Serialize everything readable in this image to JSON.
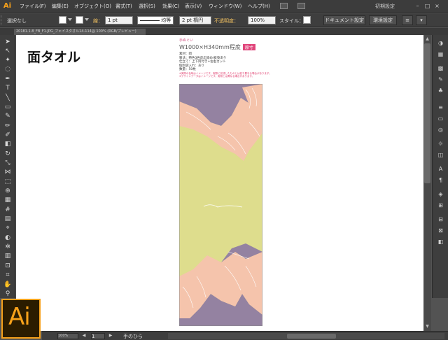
{
  "menubar": {
    "app_logo": "Ai",
    "items": [
      "ファイル(F)",
      "編集(E)",
      "オブジェクト(O)",
      "書式(T)",
      "選択(S)",
      "効果(C)",
      "表示(V)",
      "ウィンドウ(W)",
      "ヘルプ(H)"
    ],
    "workspace": "初期設定"
  },
  "controlbar": {
    "selection_state": "選択なし",
    "stroke_label": "線：",
    "stroke_weight": "1 pt",
    "profile_label": "均等",
    "brush_label": "2 pt 楕円",
    "opacity_label": "不透明度：",
    "opacity_value": "100%",
    "style_label": "スタイル：",
    "doc_setup_button": "ドキュメント設定",
    "preferences_button": "環境設定"
  },
  "tab": {
    "doc_name": "20181.1.8_FB_F1.JPG_フェイスタオル14-114@ 100% (RGB/プレビュー)"
  },
  "artboard": {
    "title": "面タオル",
    "spec": {
      "kind": "手ぬぐい",
      "size": "W1000×H340mm程度",
      "tag": "原寸",
      "lines": [
        "素材：岡",
        "製法：特色3色反応染め/抜染あり",
        "仕立て：上下阿付き+左右カット",
        "個別袋入れ：あり",
        "数量：50枚"
      ],
      "notes": [
        "※実際の色味はイメージです。実際に完成したものとは若干異なる場合があります。",
        "※デザインデータはイメージです。実物とは異なる場合があります。"
      ]
    },
    "colors": {
      "purple": "#9482a1",
      "peach": "#f5c4ac",
      "khaki": "#dedd8d",
      "border": "#8a8a8a"
    }
  },
  "statusbar": {
    "zoom": "100%",
    "page": "1",
    "current_tool": "手のひら"
  },
  "logo": {
    "text": "Ai"
  }
}
